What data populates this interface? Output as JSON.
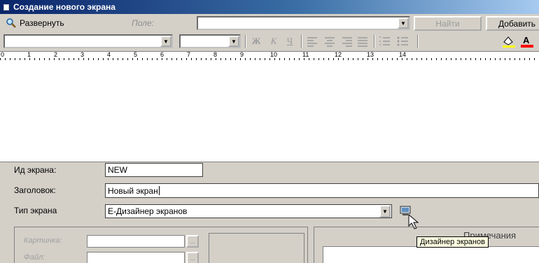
{
  "window": {
    "title": "Создание нового экрана"
  },
  "toolbar": {
    "expand_label": "Развернуть",
    "field_label": "Поле:",
    "field_value": "",
    "find_label": "Найти",
    "add_label": "Добавить"
  },
  "format": {
    "font_value": "",
    "size_value": "",
    "bold": "Ж",
    "italic": "К",
    "underline": "Ч"
  },
  "ruler": {
    "labels": [
      "0",
      "1",
      "2",
      "3",
      "4",
      "5",
      "6",
      "7",
      "8",
      "9",
      "10",
      "11",
      "12",
      "13",
      "14"
    ]
  },
  "form": {
    "id_label": "Ид экрана:",
    "id_value": "NEW",
    "caption_label": "Заголовок:",
    "caption_value": "Новый экран",
    "type_label": "Тип экрана",
    "type_value": "Е-Дизайнер экранов",
    "tooltip": "Дизайнер экранов",
    "picture_label": "Картинка:",
    "file_label": "Файл:",
    "notes_label": "Примечания"
  },
  "icons": [
    "app-icon",
    "search-icon",
    "combo-arrow-icon",
    "fill-color-icon",
    "font-color-icon",
    "screen-designer-icon"
  ]
}
